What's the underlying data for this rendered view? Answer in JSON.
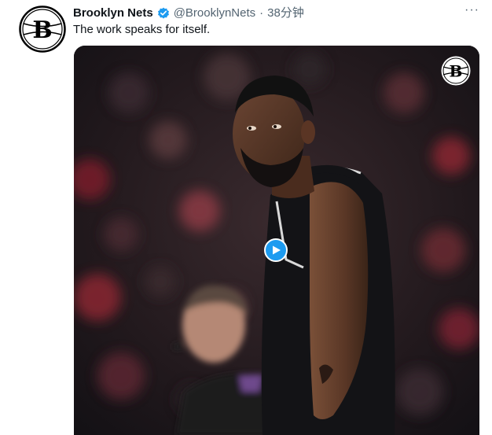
{
  "tweet": {
    "author": {
      "display_name": "Brooklyn Nets",
      "handle": "@BrooklynNets",
      "verified": true,
      "avatar_icon": "nets-logo-icon"
    },
    "separator": "·",
    "timestamp": "38分钟",
    "more_label": "···",
    "text": "The work speaks for itself.",
    "media": {
      "type": "video",
      "watermark_icon": "nets-logo-icon",
      "play_icon": "play-icon"
    }
  },
  "colors": {
    "accent": "#1d9bf0",
    "text_primary": "#0f1419",
    "text_secondary": "#536471"
  }
}
